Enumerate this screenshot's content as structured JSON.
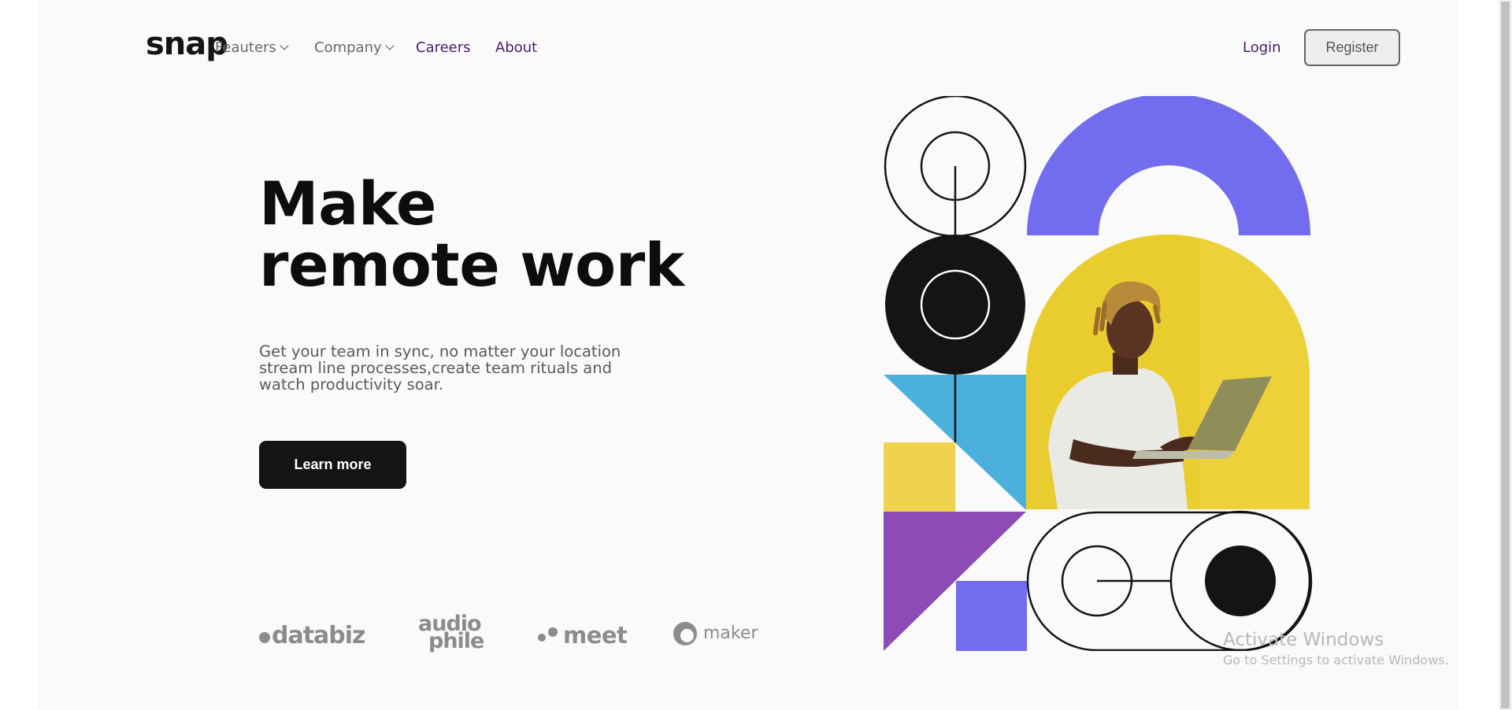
{
  "header": {
    "logo": "snap",
    "nav": {
      "features": "Feauters",
      "company": "Company",
      "careers": "Careers",
      "about": "About"
    },
    "login": "Login",
    "register": "Register"
  },
  "hero": {
    "title_line1": "Make",
    "title_line2": "remote work",
    "description_lines": [
      "Get your team in sync, no matter your location",
      "stream line processes,create team rituals and",
      "watch productivity soar."
    ],
    "cta": "Learn more"
  },
  "clients": {
    "databiz": "databiz",
    "audiophile_line1": "audio",
    "audiophile_line2": "phile",
    "meet": "meet",
    "maker": "maker"
  },
  "watermark": {
    "title": "Activate Windows",
    "subtitle": "Go to Settings to activate Windows."
  },
  "colors": {
    "purple_nav": "#4a1a6b",
    "periwinkle": "#726cee",
    "yellow": "#e7cc2e",
    "sky_blue": "#4bb0dc",
    "violet": "#8d4bb6",
    "dark": "#141414"
  }
}
